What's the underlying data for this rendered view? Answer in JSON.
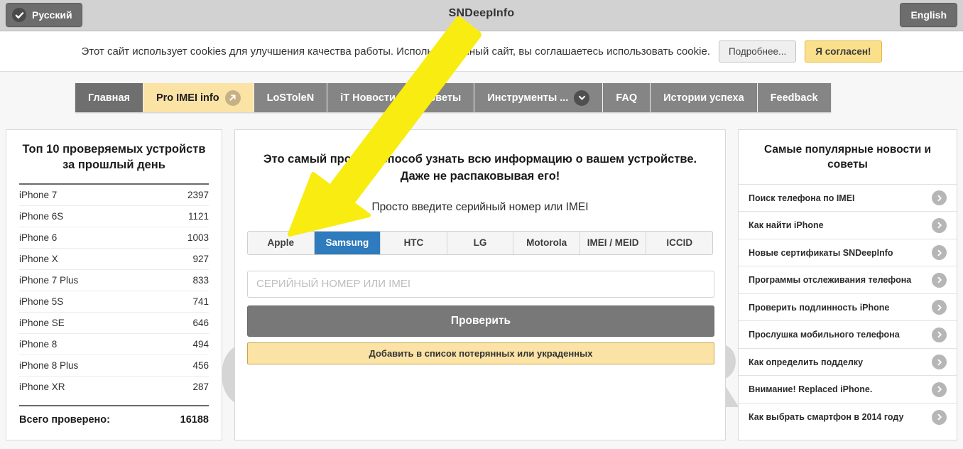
{
  "topbar": {
    "lang_left": "Русский",
    "lang_right": "English",
    "site_title": "SNDeepInfo",
    "check_icon": "check-icon"
  },
  "cookiebar": {
    "text": "Этот сайт использует cookies для улучшения качества работы. Используя данный сайт, вы соглашаетесь использовать cookie.",
    "more_label": "Подробнее...",
    "agree_label": "Я согласен!"
  },
  "nav": {
    "items": [
      {
        "label": "Главная",
        "style": "dark",
        "icon": ""
      },
      {
        "label": "Pro IMEI info",
        "style": "active",
        "icon": "external-link-icon"
      },
      {
        "label": "LoSToleN",
        "style": "normal",
        "icon": ""
      },
      {
        "label": "iT Новости",
        "style": "normal",
        "icon": ""
      },
      {
        "label": "Советы",
        "style": "normal",
        "icon": ""
      },
      {
        "label": "Инструменты ...",
        "style": "normal",
        "icon": "chevron-down-icon"
      },
      {
        "label": "FAQ",
        "style": "normal",
        "icon": ""
      },
      {
        "label": "Истории успеха",
        "style": "normal",
        "icon": ""
      },
      {
        "label": "Feedback",
        "style": "normal",
        "icon": ""
      }
    ]
  },
  "left_panel": {
    "title": "Топ 10 проверяемых устройств за прошлый день",
    "devices": [
      {
        "name": "iPhone 7",
        "count": "2397"
      },
      {
        "name": "iPhone 6S",
        "count": "1121"
      },
      {
        "name": "iPhone 6",
        "count": "1003"
      },
      {
        "name": "iPhone X",
        "count": "927"
      },
      {
        "name": "iPhone 7 Plus",
        "count": "833"
      },
      {
        "name": "iPhone 5S",
        "count": "741"
      },
      {
        "name": "iPhone SE",
        "count": "646"
      },
      {
        "name": "iPhone 8",
        "count": "494"
      },
      {
        "name": "iPhone 8 Plus",
        "count": "456"
      },
      {
        "name": "iPhone XR",
        "count": "287"
      }
    ],
    "total_label": "Всего проверено:",
    "total_value": "16188"
  },
  "mid_panel": {
    "headline_line1": "Это самый простой способ узнать всю информацию о вашем устройстве.",
    "headline_line2": "Даже не распаковывая его!",
    "subtitle": "Просто введите серийный номер или IMEI",
    "brand_tabs": [
      {
        "label": "Apple",
        "active": false
      },
      {
        "label": "Samsung",
        "active": true
      },
      {
        "label": "HTC",
        "active": false
      },
      {
        "label": "LG",
        "active": false
      },
      {
        "label": "Motorola",
        "active": false
      },
      {
        "label": "IMEI / MEID",
        "active": false
      },
      {
        "label": "ICCID",
        "active": false
      }
    ],
    "input_placeholder": "Серийный номер или IMEI",
    "input_value": "",
    "check_button": "Проверить",
    "lost_button": "Добавить в список потерянных или украденных"
  },
  "right_panel": {
    "title": "Самые популярные новости и советы",
    "news": [
      "Поиск телефона по IMEI",
      "Как найти iPhone",
      "Новые сертификаты SNDeepInfo",
      "Программы отслеживания телефона",
      "Проверить подлинность iPhone",
      "Прослушка мобильного телефона",
      "Как определить подделку",
      "Внимание! Replaced iPhone.",
      "Как выбрать смартфон в 2014 году"
    ]
  },
  "watermark": {
    "text": "KONEKTO.RU"
  },
  "annotation": {
    "arrow_color": "#f8ec10",
    "arrow_name": "yellow-pointer-arrow"
  },
  "colors": {
    "accent_yellow": "#fbe3a6",
    "accent_blue": "#2e7bbd",
    "nav_grey": "#858585",
    "topbar_grey": "#d2d2d2"
  }
}
